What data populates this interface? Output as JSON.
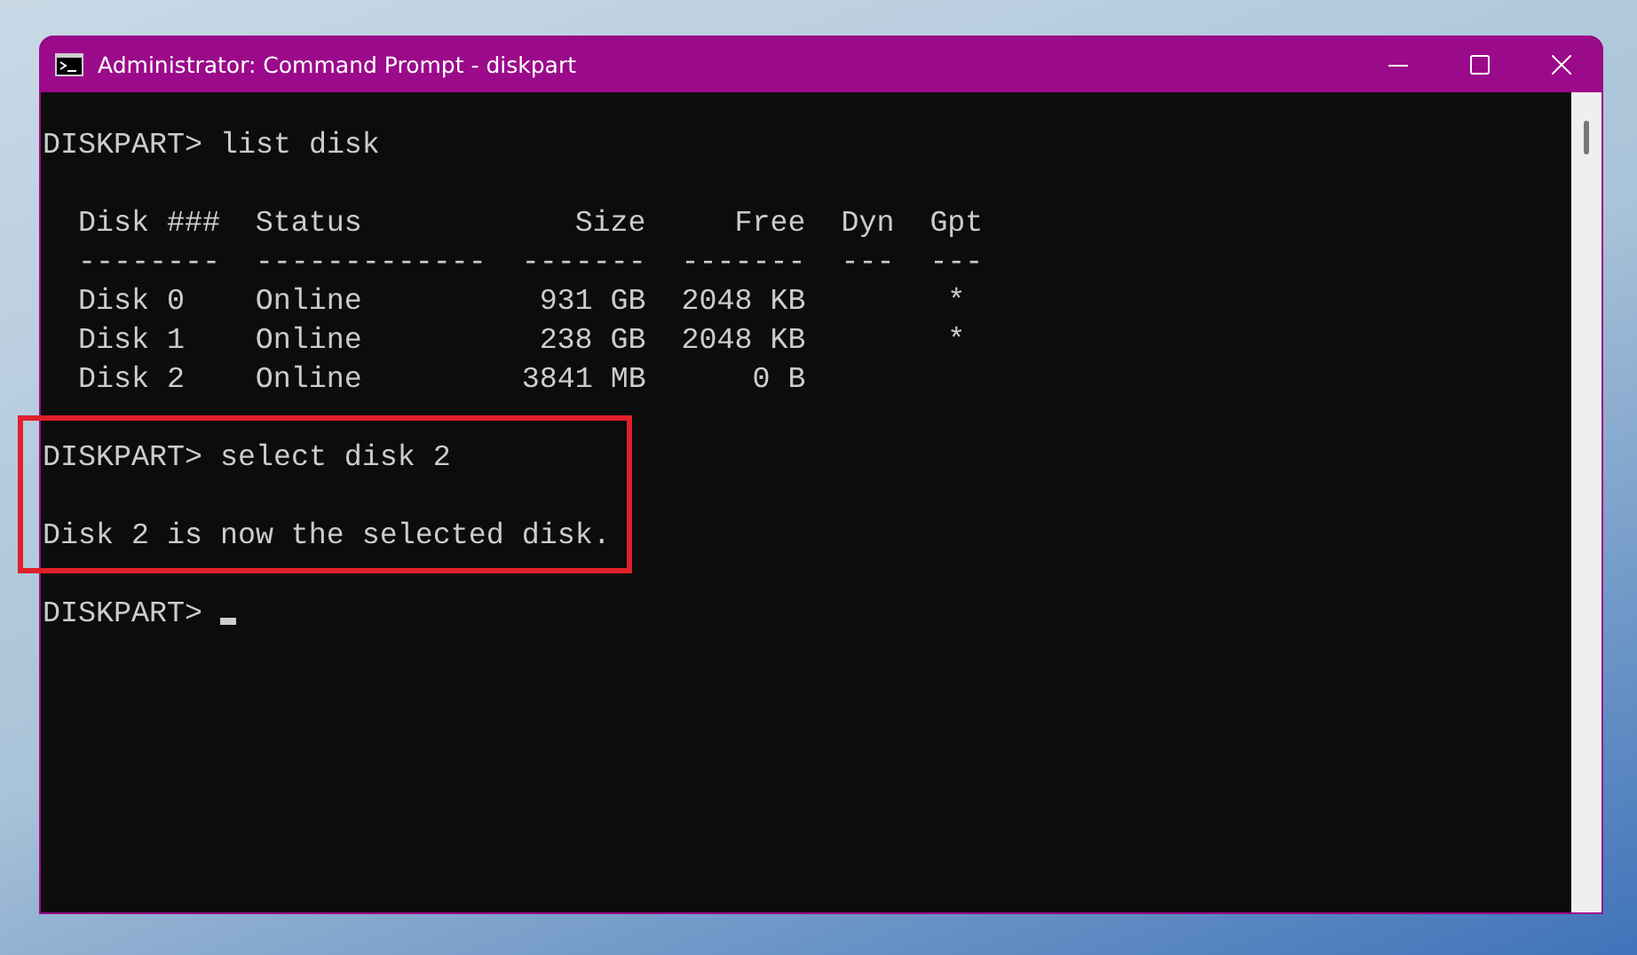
{
  "window": {
    "title": "Administrator: Command Prompt - diskpart"
  },
  "terminal": {
    "blocks": [
      {
        "kind": "command",
        "prompt": "DISKPART>",
        "command": "list disk"
      },
      {
        "kind": "table",
        "columns": [
          {
            "label": "Disk ###",
            "rule": "--------",
            "kind": "text"
          },
          {
            "label": "Status",
            "rule": "-------------",
            "kind": "text"
          },
          {
            "label": "Size",
            "rule": "-------",
            "kind": "number"
          },
          {
            "label": "Free",
            "rule": "-------",
            "kind": "number"
          },
          {
            "label": "Dyn",
            "rule": "---",
            "kind": "flag"
          },
          {
            "label": "Gpt",
            "rule": "---",
            "kind": "flag"
          }
        ],
        "rows": [
          [
            "Disk 0",
            "Online",
            "931 GB",
            "2048 KB",
            null,
            "*"
          ],
          [
            "Disk 1",
            "Online",
            "238 GB",
            "2048 KB",
            null,
            "*"
          ],
          [
            "Disk 2",
            "Online",
            "3841 MB",
            "0 B",
            null,
            null
          ]
        ]
      },
      {
        "kind": "highlight",
        "blocks": [
          {
            "kind": "command",
            "prompt": "DISKPART>",
            "command": "select disk 2"
          },
          {
            "kind": "output",
            "text": "Disk 2 is now the selected disk."
          }
        ]
      },
      {
        "kind": "command",
        "prompt": "DISKPART>",
        "cursor": true
      }
    ]
  }
}
